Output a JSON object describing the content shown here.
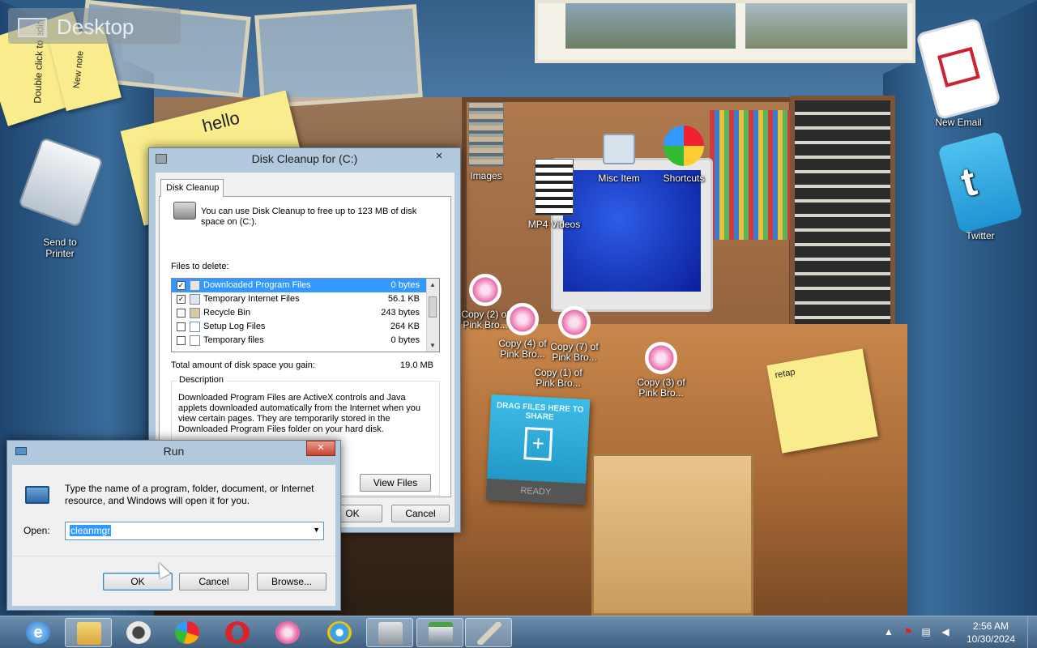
{
  "desktop": {
    "label": "Desktop",
    "sticky_notes": [
      {
        "text": "Double click to edit"
      },
      {
        "text": "New note"
      },
      {
        "text": "hello"
      },
      {
        "text": "retap"
      }
    ],
    "icons": [
      {
        "label": "Send to Printer",
        "icon": "printer-icon"
      },
      {
        "label": "Images",
        "icon": "image-stack-icon"
      },
      {
        "label": "MP4 Videos",
        "icon": "video-stack-icon"
      },
      {
        "label": "Misc Item",
        "icon": "misc-item-icon"
      },
      {
        "label": "Shortcuts",
        "icon": "shortcuts-icon"
      },
      {
        "label": "New Email",
        "icon": "email-icon"
      },
      {
        "label": "Twitter",
        "icon": "twitter-icon"
      },
      {
        "label": "Copy (2) of Pink Bro...",
        "icon": "pink-rose-icon"
      },
      {
        "label": "Copy (4) of Pink Bro...",
        "icon": "pink-rose-icon"
      },
      {
        "label": "Copy (7) of Pink Bro...",
        "icon": "pink-rose-icon"
      },
      {
        "label": "Copy (1) of Pink Bro...",
        "icon": "pink-rose-icon"
      },
      {
        "label": "Copy (3) of Pink Bro...",
        "icon": "pink-rose-icon"
      }
    ],
    "drag_tile": {
      "title": "DRAG FILES HERE TO SHARE",
      "status": "READY"
    }
  },
  "disk_cleanup": {
    "title": "Disk Cleanup for  (C:)",
    "close": "✕",
    "tab": "Disk Cleanup",
    "intro": "You can use Disk Cleanup to free up to 123 MB of disk space on  (C:).",
    "files_label": "Files to delete:",
    "files": [
      {
        "name": "Downloaded Program Files",
        "size": "0 bytes",
        "checked": true,
        "selected": true
      },
      {
        "name": "Temporary Internet Files",
        "size": "56.1 KB",
        "checked": true,
        "selected": false
      },
      {
        "name": "Recycle Bin",
        "size": "243 bytes",
        "checked": false,
        "selected": false
      },
      {
        "name": "Setup Log Files",
        "size": "264 KB",
        "checked": false,
        "selected": false
      },
      {
        "name": "Temporary files",
        "size": "0 bytes",
        "checked": false,
        "selected": false
      }
    ],
    "total_label": "Total amount of disk space you gain:",
    "total_value": "19.0 MB",
    "description_title": "Description",
    "description": "Downloaded Program Files are ActiveX controls and Java applets downloaded automatically from the Internet when you view certain pages. They are temporarily stored in the Downloaded Program Files folder on your hard disk.",
    "view_files": "View Files",
    "ok": "OK",
    "cancel": "Cancel"
  },
  "run": {
    "title": "Run",
    "close": "✕",
    "prompt": "Type the name of a program, folder, document, or Internet resource, and Windows will open it for you.",
    "open_label": "Open:",
    "open_value": "cleanmgr",
    "ok": "OK",
    "cancel": "Cancel",
    "browse": "Browse..."
  },
  "taskbar": {
    "apps": [
      {
        "name": "internet-explorer",
        "active": false,
        "color": "#2d8fe0"
      },
      {
        "name": "file-explorer",
        "active": true,
        "color": "#e9c25a"
      },
      {
        "name": "media-player",
        "active": false,
        "color": "#dcdcdc"
      },
      {
        "name": "app-colorful",
        "active": false,
        "color": "#f0a020"
      },
      {
        "name": "opera",
        "active": false,
        "color": "#d8242a"
      },
      {
        "name": "pink-rose",
        "active": false,
        "color": "#e86aa7"
      },
      {
        "name": "video-call",
        "active": false,
        "color": "#3aa0e8"
      },
      {
        "name": "disk-cleanup",
        "active": true,
        "color": "#b9bcc0"
      },
      {
        "name": "run",
        "active": true,
        "color": "#b9bcc0"
      },
      {
        "name": "pen-tool",
        "active": true,
        "color": "#d8d2c0"
      }
    ],
    "time": "2:56 AM",
    "date": "10/30/2024"
  }
}
